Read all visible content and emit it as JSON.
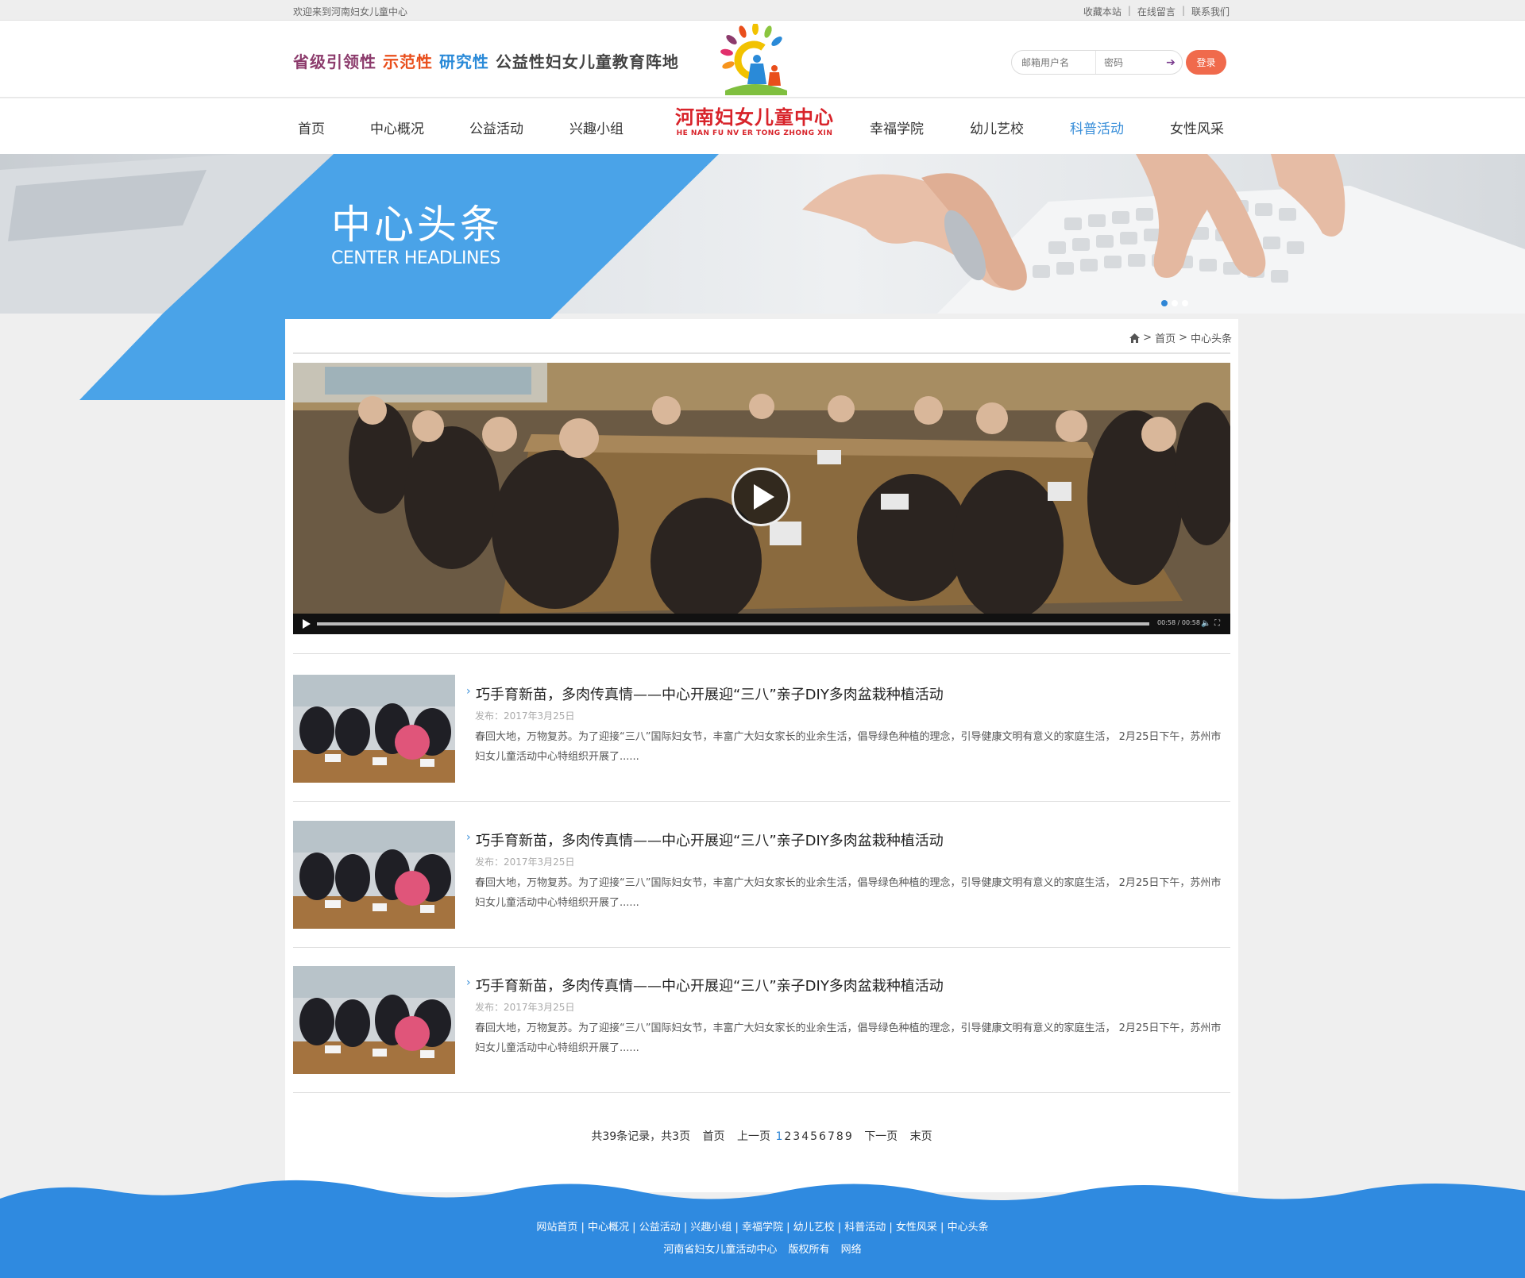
{
  "topbar": {
    "welcome": "欢迎来到河南妇女儿童中心",
    "links": [
      "收藏本站",
      "在线留言",
      "联系我们"
    ]
  },
  "header": {
    "slogan": {
      "part1": "省级引领性",
      "part2": "示范性",
      "part3": "研究性",
      "part4": "公益性妇女儿童教育阵地"
    },
    "login": {
      "user_placeholder": "邮箱用户名",
      "password_placeholder": "密码",
      "submit_label": "登录"
    },
    "logo": {
      "cn": "河南妇女儿童中心",
      "en": "HE NAN FU NV ER TONG  ZHONG XIN"
    }
  },
  "nav": {
    "items": [
      "首页",
      "中心概况",
      "公益活动",
      "兴趣小组",
      "幸福学院",
      "幼儿艺校",
      "科普活动",
      "女性风采"
    ],
    "active": "科普活动"
  },
  "banner": {
    "title_cn": "中心头条",
    "title_en": "CENTER HEADLINES",
    "slide_count": 3,
    "active_slide": 1
  },
  "breadcrumb": {
    "home": "首页",
    "separator": ">",
    "current": "中心头条"
  },
  "video": {
    "current_time": "00:58",
    "duration": "00:58",
    "time_separator": "/"
  },
  "news": [
    {
      "title": "巧手育新苗，多肉传真情——中心开展迎“三八”亲子DIY多肉盆栽种植活动",
      "date": "发布：2017年3月25日",
      "desc": "春回大地，万物复苏。为了迎接“三八”国际妇女节，丰富广大妇女家长的业余生活，倡导绿色种植的理念，引导健康文明有意义的家庭生活， 2月25日下午，苏州市妇女儿童活动中心特组织开展了......"
    },
    {
      "title": "巧手育新苗，多肉传真情——中心开展迎“三八”亲子DIY多肉盆栽种植活动",
      "date": "发布：2017年3月25日",
      "desc": "春回大地，万物复苏。为了迎接“三八”国际妇女节，丰富广大妇女家长的业余生活，倡导绿色种植的理念，引导健康文明有意义的家庭生活， 2月25日下午，苏州市妇女儿童活动中心特组织开展了......"
    },
    {
      "title": "巧手育新苗，多肉传真情——中心开展迎“三八”亲子DIY多肉盆栽种植活动",
      "date": "发布：2017年3月25日",
      "desc": "春回大地，万物复苏。为了迎接“三八”国际妇女节，丰富广大妇女家长的业余生活，倡导绿色种植的理念，引导健康文明有意义的家庭生活， 2月25日下午，苏州市妇女儿童活动中心特组织开展了......"
    }
  ],
  "pager": {
    "summary": "共39条记录，共3页",
    "first": "首页",
    "prev": "上一页",
    "pages": [
      "1",
      "2",
      "3",
      "4",
      "5",
      "6",
      "7",
      "8",
      "9"
    ],
    "current": "1",
    "next": "下一页",
    "last": "末页"
  },
  "footer": {
    "links": "网站首页 | 中心概况 | 公益活动 | 兴趣小组 | 幸福学院 | 幼儿艺校 | 科普活动 | 女性风采 | 中心头条",
    "org": "河南省妇女儿童活动中心",
    "rights": "版权所有",
    "site": "网络"
  },
  "colors": {
    "accent_blue": "#2f86d6",
    "login_orange": "#f06a4c",
    "logo_red": "#d8232a"
  }
}
